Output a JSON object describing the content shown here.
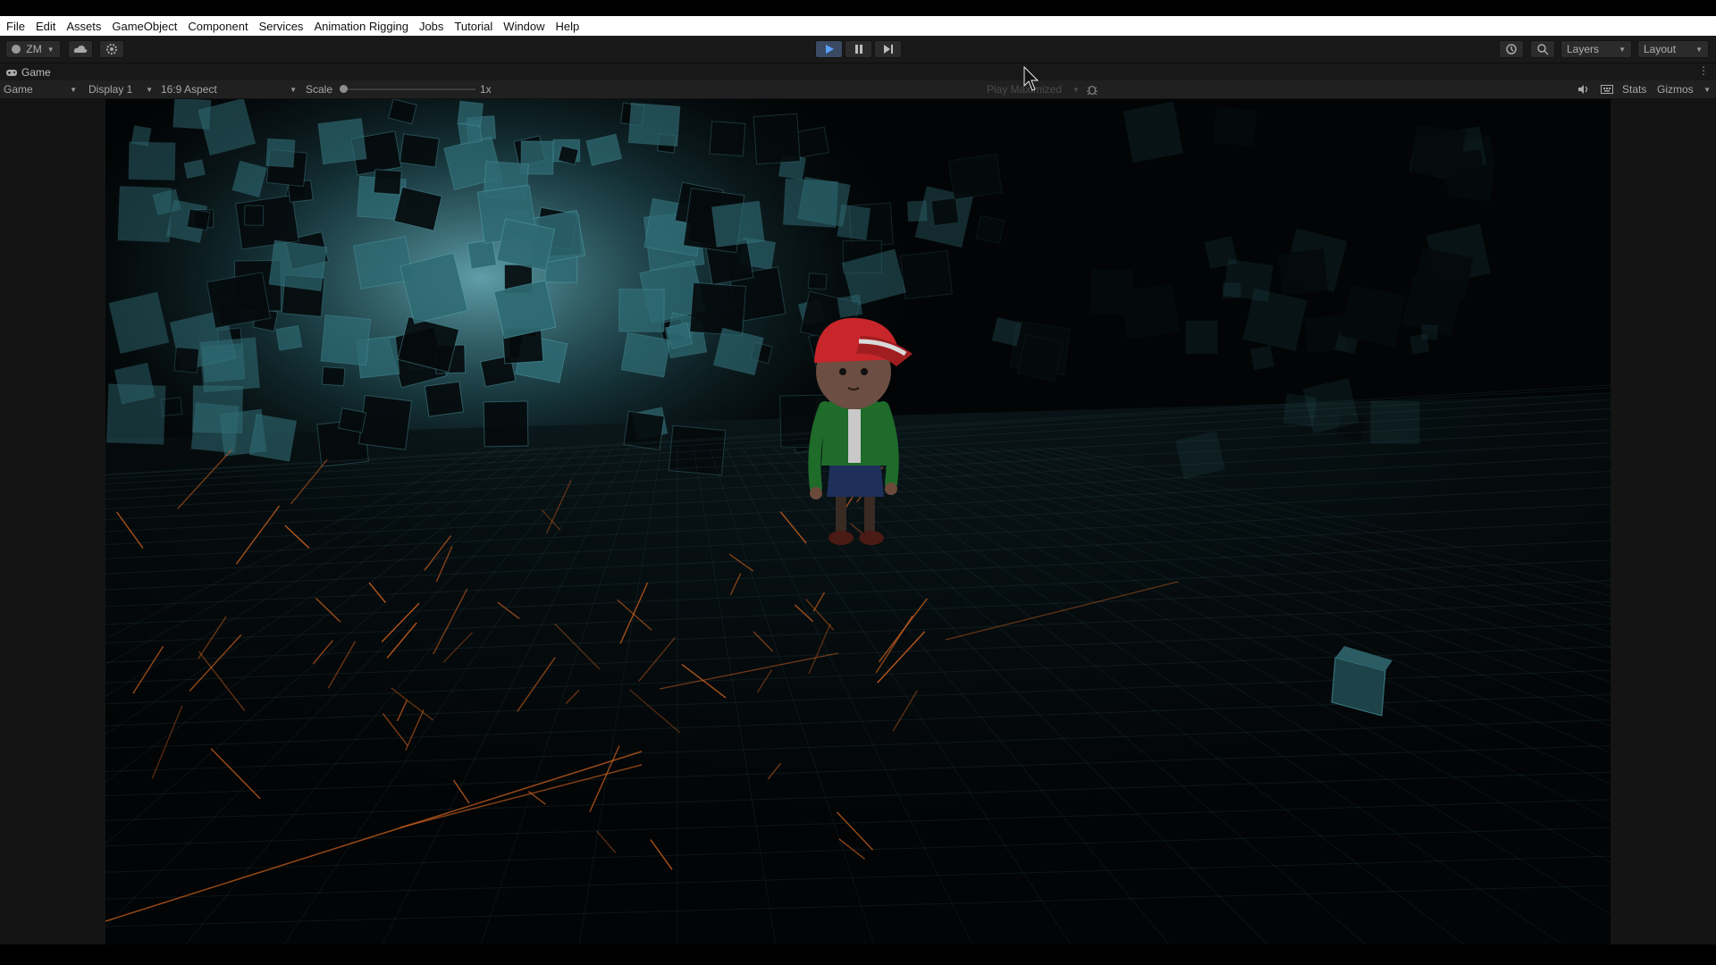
{
  "menu": [
    "File",
    "Edit",
    "Assets",
    "GameObject",
    "Component",
    "Services",
    "Animation Rigging",
    "Jobs",
    "Tutorial",
    "Window",
    "Help"
  ],
  "toolbar": {
    "account_label": "ZM",
    "layers_label": "Layers",
    "layout_label": "Layout",
    "play_active": true
  },
  "tab": {
    "label": "Game"
  },
  "game_bar": {
    "mode": "Game",
    "display": "Display 1",
    "aspect": "16:9 Aspect",
    "scale_label": "Scale",
    "scale_value": "1x",
    "play_mode": "Play Maximized",
    "stats": "Stats",
    "gizmos": "Gizmos"
  },
  "colors": {
    "scene_background": "#020405",
    "cube_teal": "#2f6a73",
    "grid_orange": "#d9651f",
    "character_cap": "#c8262a",
    "character_jacket": "#1f6b2a"
  }
}
